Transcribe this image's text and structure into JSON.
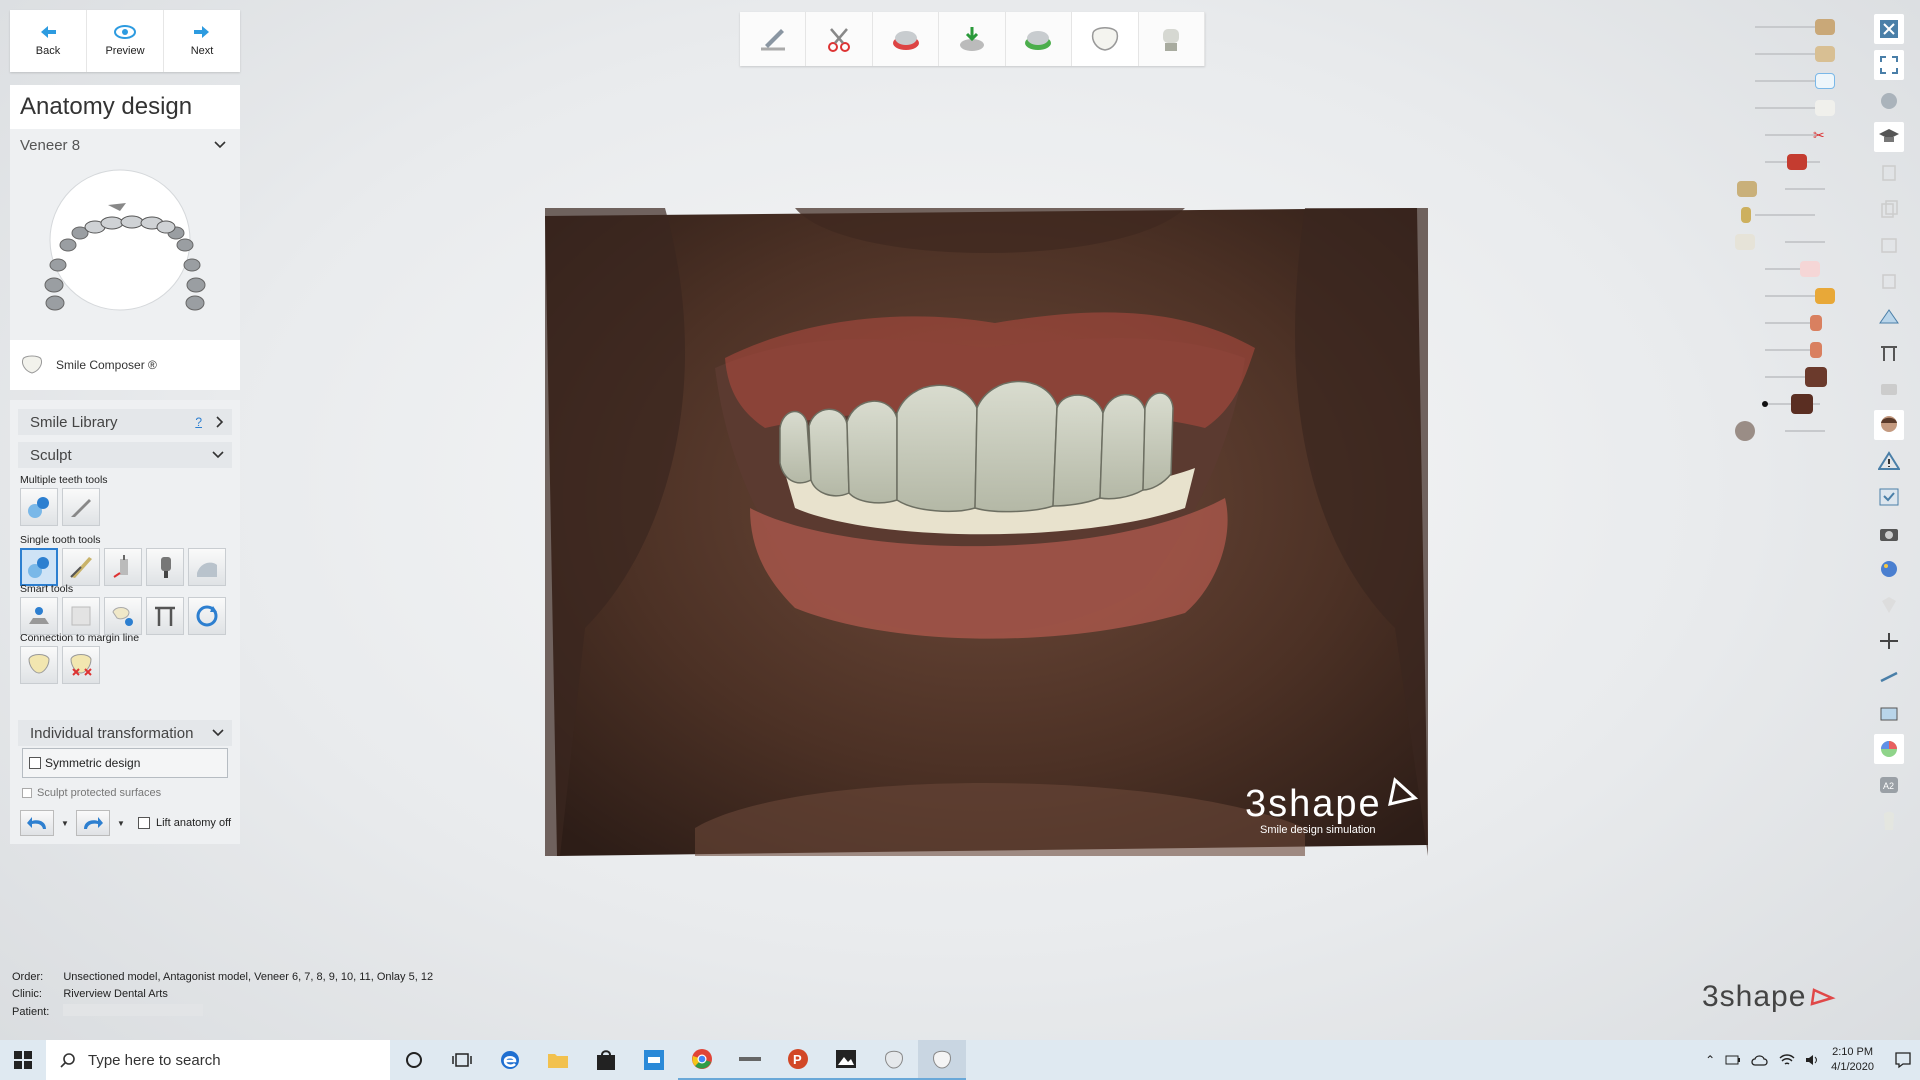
{
  "nav": {
    "back": "Back",
    "preview": "Preview",
    "next": "Next"
  },
  "panel": {
    "title": "Anatomy design",
    "tooth": "Veneer 8",
    "composer": "Smile Composer ®",
    "smile_library": "Smile Library",
    "help": "?",
    "sculpt": "Sculpt",
    "multiple_teeth_tools": "Multiple teeth tools",
    "single_tooth_tools": "Single tooth tools",
    "smart_tools": "Smart tools",
    "connection_margin": "Connection to margin line",
    "individual_transformation": "Individual transformation",
    "symmetric_design": "Symmetric design",
    "sculpt_protected": "Sculpt protected surfaces",
    "lift_anatomy": "Lift anatomy off"
  },
  "photo": {
    "watermark": "3shape",
    "watermark_sub": "Smile design simulation"
  },
  "order": {
    "order_label": "Order:",
    "order_value": "Unsectioned model, Antagonist model, Veneer 6, 7, 8, 9, 10, 11, Onlay 5, 12",
    "clinic_label": "Clinic:",
    "clinic_value": "Riverview Dental Arts",
    "patient_label": "Patient:"
  },
  "brand": "3shape",
  "taskbar": {
    "search_placeholder": "Type here to search",
    "time": "2:10 PM",
    "date": "4/1/2020"
  },
  "colors": {
    "accent": "#2d7fd0",
    "panel": "#eef0f2",
    "gum": "#c0504d",
    "tooth": "#dfe1d6"
  }
}
